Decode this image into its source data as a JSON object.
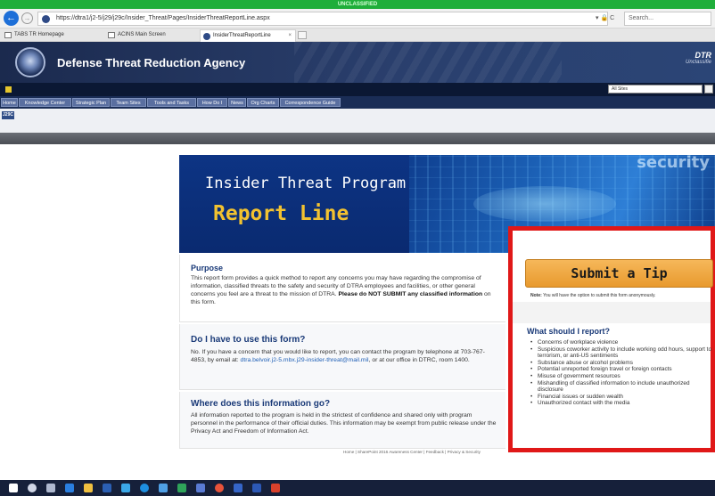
{
  "classification": "UNCLASSIFIED",
  "browser": {
    "url": "https://dtra1/j2-5/j29/j29c/Insider_Threat/Pages/InsiderThreatReportLine.aspx",
    "tools": "▾ 🔒 C",
    "search_placeholder": "Search...",
    "favorites": [
      "TABS TR Homepage",
      "ACINS Main Screen"
    ],
    "active_tab": "InsiderThreatReportLine",
    "icons": [
      "back-arrow-icon",
      "forward-arrow-icon",
      "lock-icon",
      "refresh-icon",
      "close-icon"
    ]
  },
  "header": {
    "agency_name": "Defense Threat Reduction Agency",
    "right_title": "DTR",
    "right_subtitle": "Unclassifie"
  },
  "site_select": "All Sites",
  "nav": {
    "items": [
      {
        "label": "Home"
      },
      {
        "label": "Knowledge Center"
      },
      {
        "label": "Strategic Plan"
      },
      {
        "label": "Team Sites"
      },
      {
        "label": "Tools and Tasks"
      },
      {
        "label": "How Do I"
      },
      {
        "label": "News"
      },
      {
        "label": "Org Charts"
      },
      {
        "label": "Correspondence Guide"
      }
    ]
  },
  "badge": "J29C",
  "banner": {
    "title": "Insider Threat Program",
    "subtitle": "Report Line",
    "watermark": "security"
  },
  "purpose": {
    "title": "Purpose",
    "body": "This report form provides a quick method to report any concerns you may have regarding the compromise of information, classified threats to the safety and security of DTRA employees and facilities, or other general concerns you feel are a threat to the mission of DTRA.",
    "warning": "Please do NOT SUBMIT any classified information",
    "tail": "on this form."
  },
  "use_form": {
    "title": "Do I have to use this form?",
    "body": "No. If you have a concern that you would like to report, you can contact the program by telephone at 703-767-4853, by email at:",
    "email": "dtra.belvoir.j2-5.mbx.j29-insider-threat@mail.mil",
    "tail": ", or at our office in DTRC, room 1400."
  },
  "info_go": {
    "title": "Where does this information go?",
    "body": "All information reported to the program is held in the strictest of confidence and shared only with program personnel in the performance of their official duties. This information may be exempt from public release under the Privacy Act and Freedom of Information Act."
  },
  "tip": {
    "button": "Submit a Tip",
    "note_label": "Note:",
    "note": "You will have the option to submit this form anonymously.",
    "what_title": "What should I report?",
    "items": [
      "Concerns of workplace violence",
      "Suspicious coworker activity to include working odd hours, support to terrorism, or anti-US sentiments",
      "Substance abuse or alcohol problems",
      "Potential unreported foreign travel or foreign contacts",
      "Misuse of government resources",
      "Mishandling of classified information to include unauthorized disclosure",
      "Financial issues or sudden wealth",
      "Unauthorized contact with the media"
    ]
  },
  "footer": "Home | SharePoint 2016 Awareness Center | Feedback | Privacy & Security",
  "colors": {
    "classification_banner": "#1fae3a",
    "header_navy": "#1b2a4e",
    "title_blue": "#1a3a78",
    "report_line_gold": "#f2c230",
    "submit_orange": "#e89a2e",
    "highlight_red": "#e01818"
  }
}
